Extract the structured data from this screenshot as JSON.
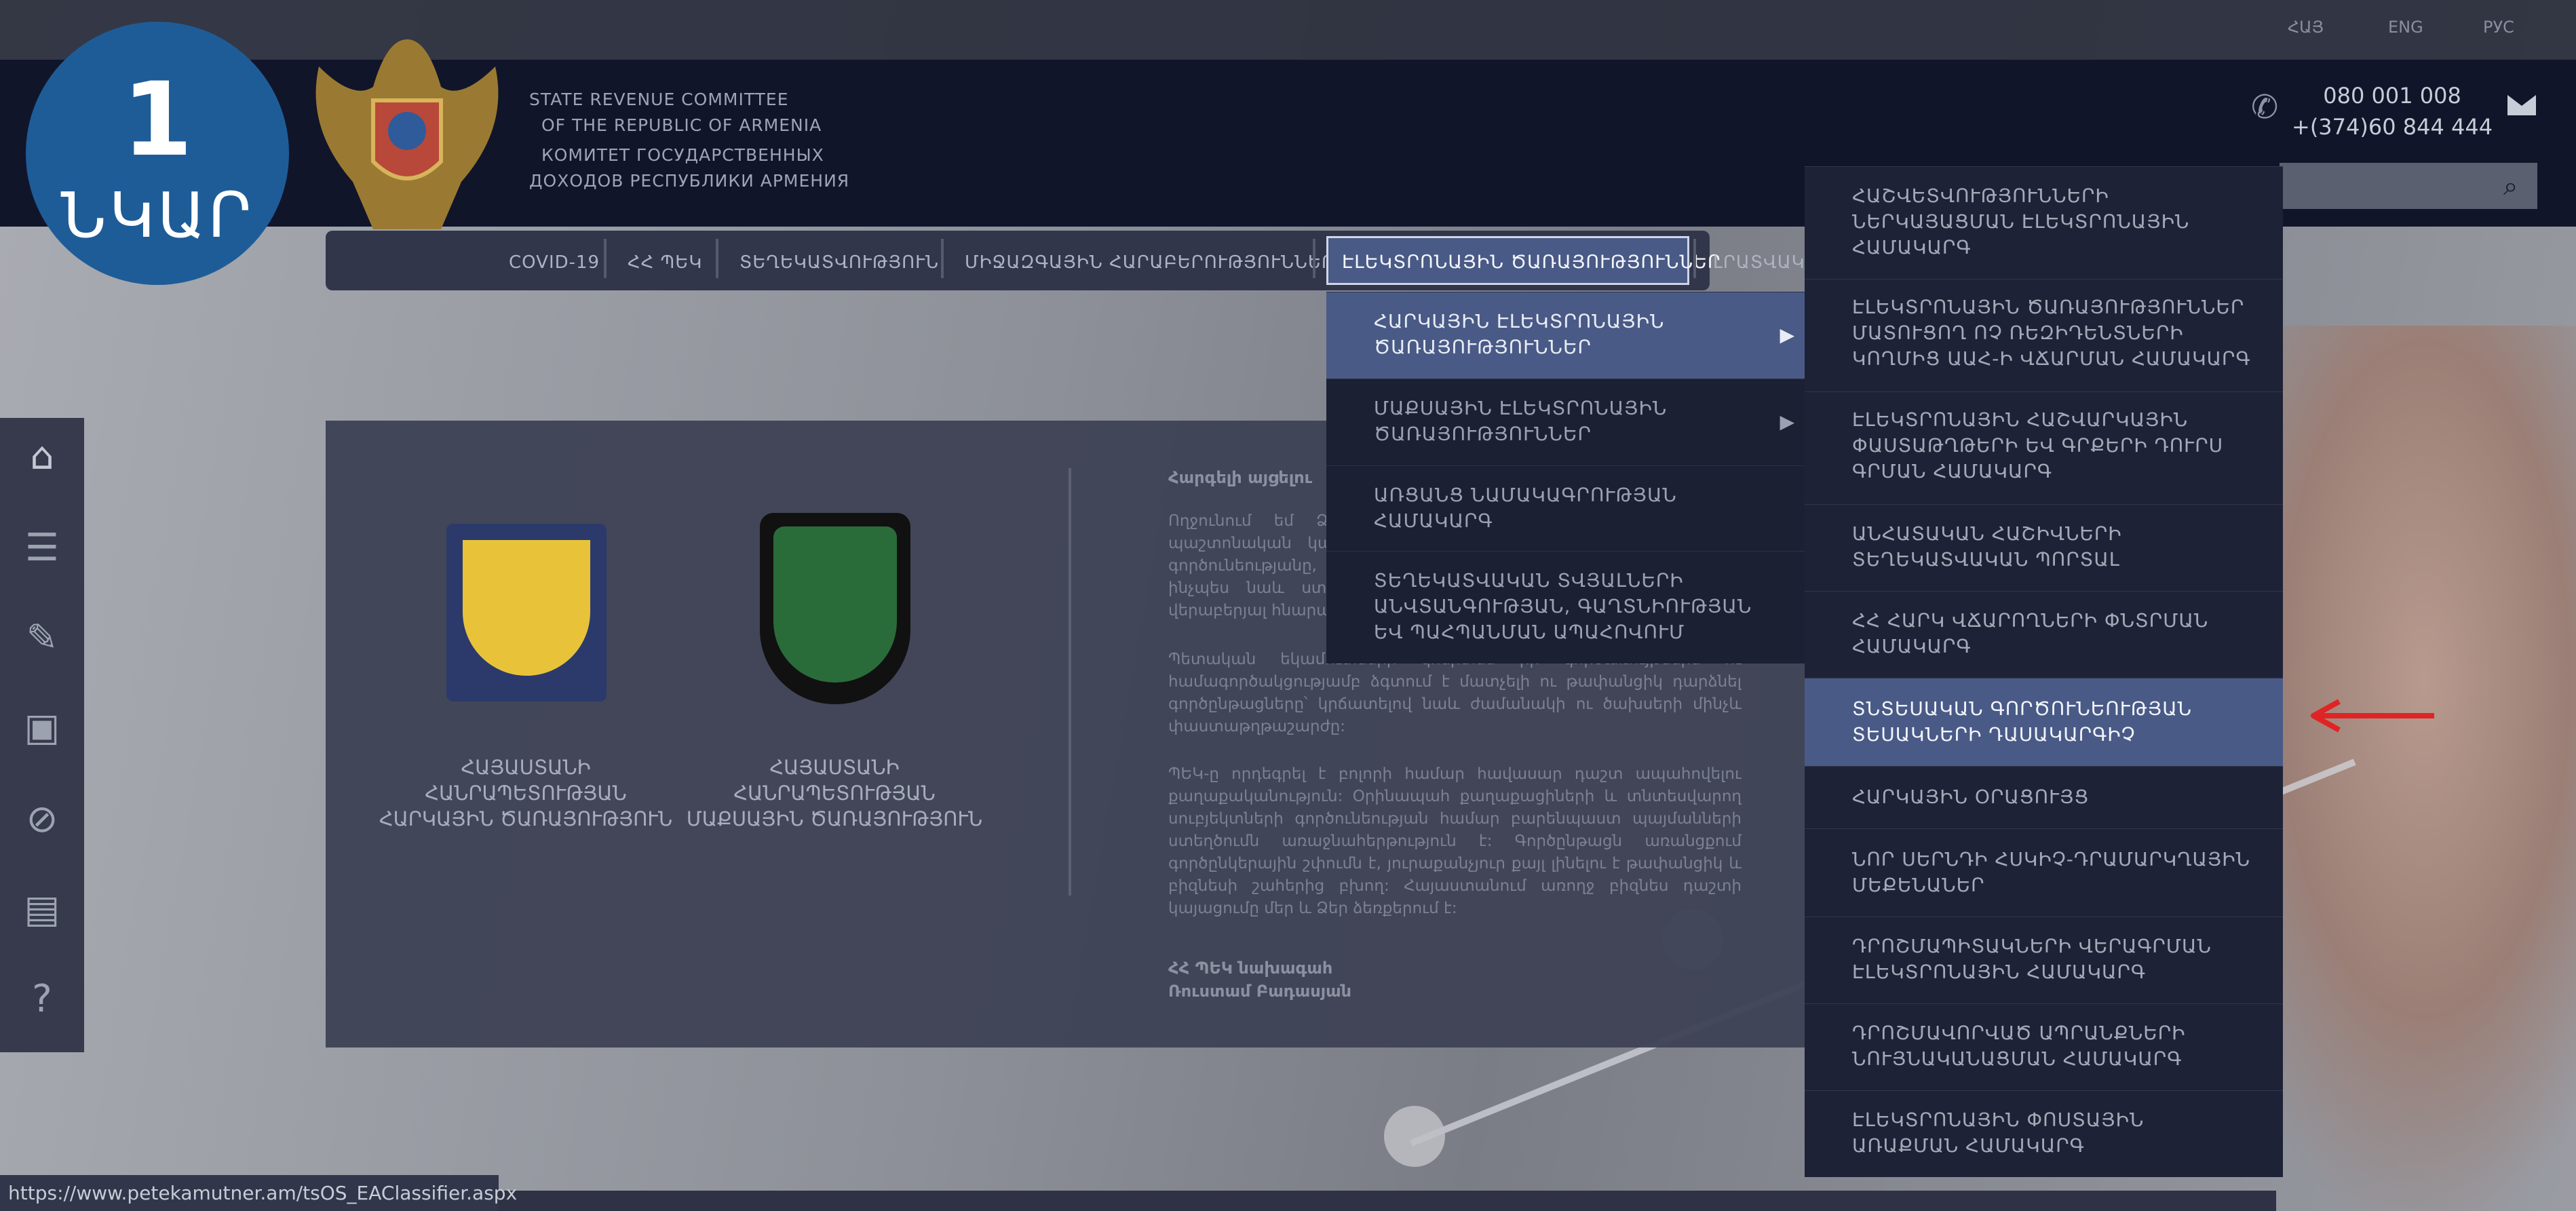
{
  "badge": {
    "number": "1",
    "label": "ՆԿԱՐ"
  },
  "languages": [
    "ՀԱՅ",
    "ENG",
    "РУС"
  ],
  "org": {
    "line1": "STATE REVENUE COMMITTEE",
    "line2": "OF THE REPUBLIC OF ARMENIA",
    "line3": "КОМИТЕТ ГОСУДАРСТВЕННЫХ",
    "line4": "ДОХОДОВ РЕСПУБЛИКИ АРМЕНИЯ"
  },
  "contact": {
    "phone1": "080 001 008",
    "phone2": "+(374)60 844 444"
  },
  "nav": {
    "items": [
      "COVID-19",
      "ՀՀ ՊԵԿ",
      "ՏԵՂԵԿԱՏՎՈՒԹՅՈՒՆ",
      "ՄԻՋԱԶԳԱՅԻՆ ՀԱՐԱԲԵՐՈՒԹՅՈՒՆՆԵՐ"
    ],
    "active": "ԷԼԵԿՏՐՈՆԱՅԻՆ ԾԱՌԱՅՈՒԹՅՈՒՆՆԵՐ",
    "partial": "ԼՐԱՏՎԱԿ"
  },
  "submenu1": [
    {
      "label": "ՀԱՐԿԱՅԻՆ ԷԼԵԿՏՐՈՆԱՅԻՆ ԾԱՌԱՅՈՒԹՅՈՒՆՆԵՐ",
      "has_children": true,
      "active": true
    },
    {
      "label": "ՄԱՔՍԱՅԻՆ ԷԼԵԿՏՐՈՆԱՅԻՆ ԾԱՌԱՅՈՒԹՅՈՒՆՆԵՐ",
      "has_children": true,
      "active": false
    },
    {
      "label": "ԱՌՑԱՆՑ ՆԱՄԱԿԱԳՐՈՒԹՅԱՆ ՀԱՄԱԿԱՐԳ",
      "has_children": false,
      "active": false
    },
    {
      "label": "ՏԵՂԵԿԱՏՎԱԿԱՆ ՏՎՅԱԼՆԵՐԻ ԱՆՎՏԱՆԳՈՒԹՅԱՆ, ԳԱՂՏՆԻՈՒԹՅԱՆ ԵՎ ՊԱՀՊԱՆՄԱՆ ԱՊԱՀՈՎՈՒՄ",
      "has_children": false,
      "active": false
    }
  ],
  "submenu2": [
    {
      "label": "ՀԱՇՎԵՏՎՈՒԹՅՈՒՆՆԵՐԻ ՆԵՐԿԱՅԱՑՄԱՆ ԷԼԵԿՏՐՈՆԱՅԻՆ ՀԱՄԱԿԱՐԳ",
      "active": false
    },
    {
      "label": "ԷԼԵԿՏՐՈՆԱՅԻՆ ԾԱՌԱՅՈՒԹՅՈՒՆՆԵՐ ՄԱՏՈՒՑՈՂ ՈՉ ՌԵԶԻԴԵՆՏՆԵՐԻ ԿՈՂՄԻՑ ԱԱՀ-Ի ՎՃԱՐՄԱՆ ՀԱՄԱԿԱՐԳ",
      "active": false
    },
    {
      "label": "ԷԼԵԿՏՐՈՆԱՅԻՆ ՀԱՇՎԱՐԿԱՅԻՆ ՓԱՍՏԱԹՂԹԵՐԻ ԵՎ ԳՐՔԵՐԻ ԴՈՒՐՍ ԳՐՄԱՆ ՀԱՄԱԿԱՐԳ",
      "active": false
    },
    {
      "label": "ԱՆՀԱՏԱԿԱՆ ՀԱՇԻՎՆԵՐԻ ՏԵՂԵԿԱՏՎԱԿԱՆ ՊՈՐՏԱԼ",
      "active": false
    },
    {
      "label": "ՀՀ ՀԱՐԿ ՎՃԱՐՈՂՆԵՐԻ ՓՆՏՐՄԱՆ ՀԱՄԱԿԱՐԳ",
      "active": false
    },
    {
      "label": "ՏՆՏԵՍԱԿԱՆ ԳՈՐԾՈՒՆԵՈՒԹՅԱՆ ՏԵՍԱԿՆԵՐԻ ԴԱՍԱԿԱՐԳԻՉ",
      "active": true
    },
    {
      "label": "ՀԱՐԿԱՅԻՆ ՕՐԱՑՈՒՅՑ",
      "active": false
    },
    {
      "label": "ՆՈՐ ՍԵՐՆԴԻ ՀՍԿԻՉ-ԴՐԱՄԱՐԿՂԱՅԻՆ ՄԵՔԵՆԱՆԵՐ",
      "active": false
    },
    {
      "label": "ԴՐՈՇՄԱՊԻՏԱԿՆԵՐԻ ՎԵՐԱԳՐՄԱՆ ԷԼԵԿՏՐՈՆԱՅԻՆ ՀԱՄԱԿԱՐԳ",
      "active": false
    },
    {
      "label": "ԴՐՈՇՄԱՎՈՐՎԱԾ ԱՊՐԱՆՔՆԵՐԻ ՆՈՒՅՆԱԿԱՆԱՑՄԱՆ ՀԱՄԱԿԱՐԳ",
      "active": false
    },
    {
      "label": "ԷԼԵԿՏՐՈՆԱՅԻՆ ՓՈՍՏԱՅԻՆ ԱՌԱՔՄԱՆ ՀԱՄԱԿԱՐԳ",
      "active": false
    }
  ],
  "emblems": [
    {
      "label": "ՀԱՅԱՍՏԱՆԻ ՀԱՆՐԱՊԵՏՈՒԹՅԱՆ ՀԱՐԿԱՅԻՆ ԾԱՌԱՅՈՒԹՅՈՒՆ",
      "color": "#e8c33a"
    },
    {
      "label": "ՀԱՅԱՍՏԱՆԻ ՀԱՆՐԱՊԵՏՈՒԹՅԱՆ ՄԱՔՍԱՅԻՆ ԾԱՌԱՅՈՒԹՅՈՒՆ",
      "color": "#2a6b3a"
    }
  ],
  "message": {
    "title": "Հարգելի այցելու",
    "p1": "Ողջունում եմ Ձեզ ՀՀ պետական եկամուտների կոմիտեի պաշտոնական կայքէջում: Այստեղ կարող եք ծանոթանալ մեր գործունեությանը, կապված անհրաժեշտ տեղեկատվությանը, ինչպես նաև ստանալ Ձեր հարցերի և առաջարկությունների վերաբերյալ հնարավորությունից",
    "p2": "Պետական եկամուտների կոմիտեն իր գործառույթներն ու համագործակցությամբ ձգտում է մատչելի ու թափանցիկ դարձնել գործընթացները՝ կրճատելով նաև ժամանակի ու ծախսերի մինչև փաստաթղթաշարժը:",
    "p3": "ՊԵԿ-ը որդեգրել է բոլորի համար հավասար դաշտ ապահովելու քաղաքականություն: Օրինապահ քաղաքացիների և տնտեսվարող սուբյեկտների գործունեության համար բարենպաստ պայմանների ստեղծումն առաջնահերթություն է: Գործընթացն առանցքում գործընկերային շփումն է, յուրաքանչյուր քայլ լինելու է թափանցիկ և բիզնեսի շահերից բխող: Հայաստանում առողջ բիզնես դաշտի կայացումը մեր և Ձեր ձեռքերում է:",
    "sign_role": "ՀՀ ՊԵԿ նախագահ",
    "sign_name": "Ռուստամ Բադասյան"
  },
  "status_url": "https://www.petekamutner.am/tsOS_EAClassifier.aspx",
  "colors": {
    "badge": "#1e5c98",
    "header": "#11152a",
    "active_menu": "#4a5a86",
    "arrow": "#e02424"
  }
}
